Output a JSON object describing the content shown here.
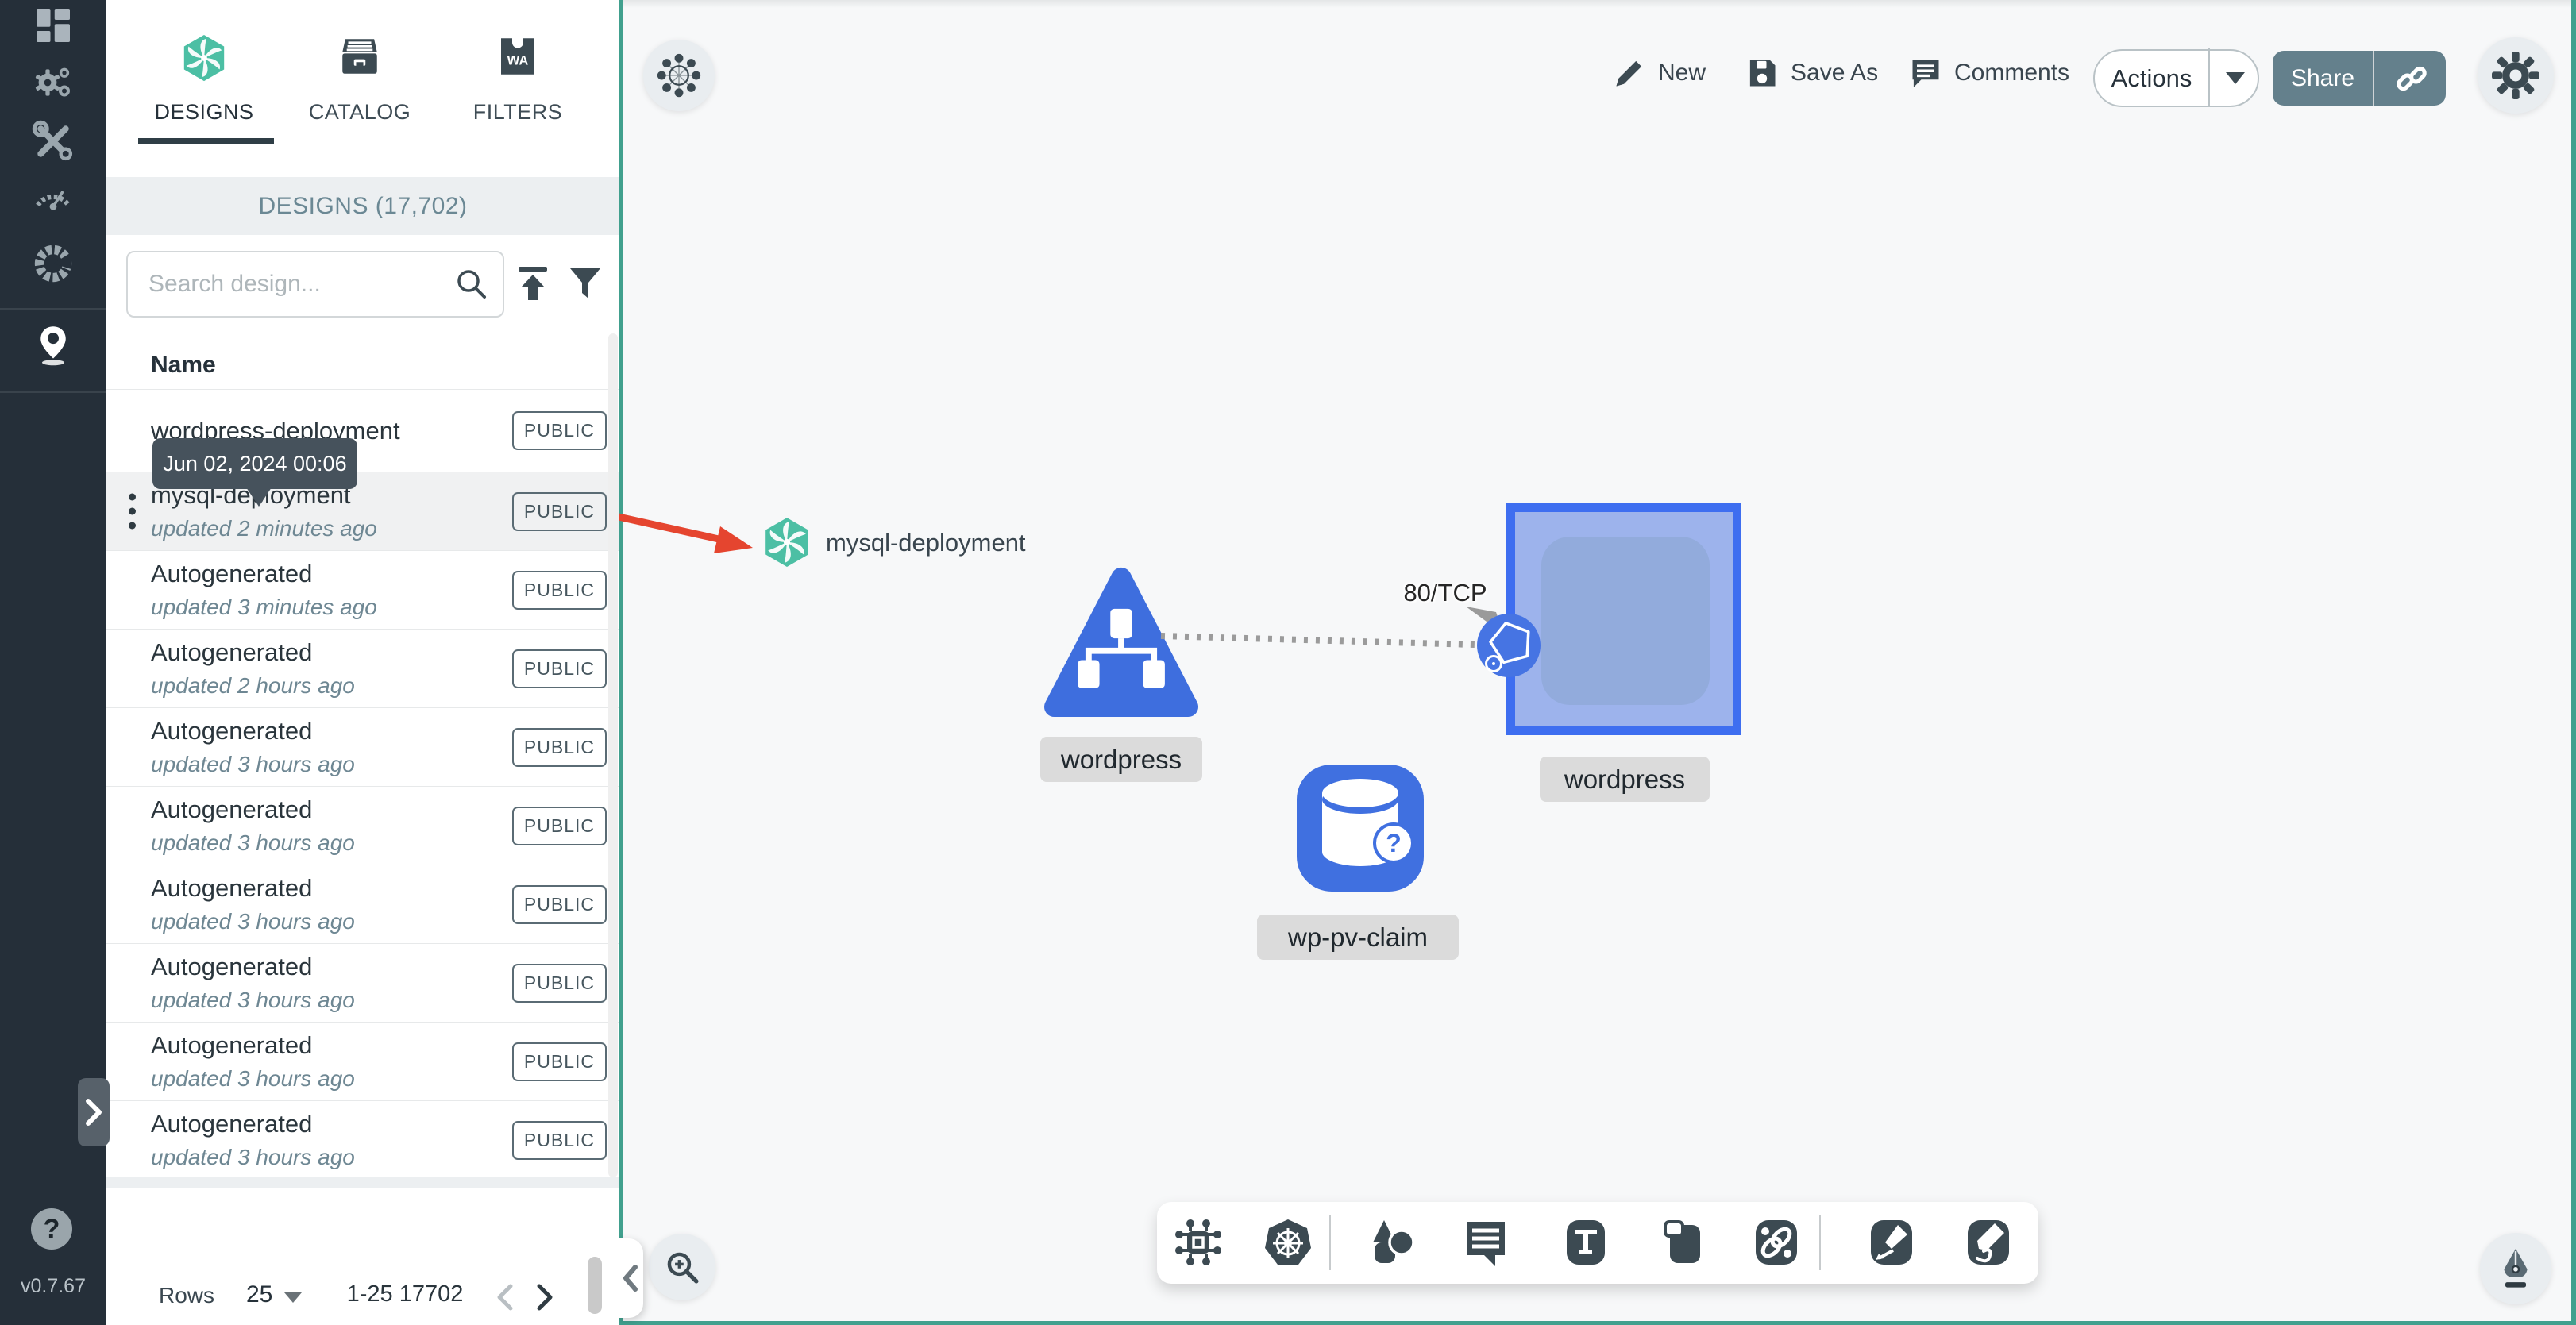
{
  "sidebar": {
    "icons": [
      "dashboard",
      "lifecycle",
      "configuration",
      "performance",
      "extensions",
      "kanvas"
    ],
    "help": "?",
    "version": "v0.7.67"
  },
  "panel": {
    "tabs": [
      {
        "label": "DESIGNS",
        "active": true
      },
      {
        "label": "CATALOG",
        "active": false
      },
      {
        "label": "FILTERS",
        "active": false
      }
    ],
    "header": "DESIGNS (17,702)",
    "search_placeholder": "Search design...",
    "table_header": "Name",
    "tooltip": "Jun 02, 2024 00:06",
    "rows": [
      {
        "name": "wordpress-deployment",
        "subtitle": "",
        "badge": "PUBLIC",
        "hovered": false
      },
      {
        "name": "mysql-deployment",
        "subtitle": "updated 2 minutes ago",
        "badge": "PUBLIC",
        "hovered": true
      },
      {
        "name": "Autogenerated",
        "subtitle": "updated 3 minutes ago",
        "badge": "PUBLIC",
        "hovered": false
      },
      {
        "name": "Autogenerated",
        "subtitle": "updated 2 hours ago",
        "badge": "PUBLIC",
        "hovered": false
      },
      {
        "name": "Autogenerated",
        "subtitle": "updated 3 hours ago",
        "badge": "PUBLIC",
        "hovered": false
      },
      {
        "name": "Autogenerated",
        "subtitle": "updated 3 hours ago",
        "badge": "PUBLIC",
        "hovered": false
      },
      {
        "name": "Autogenerated",
        "subtitle": "updated 3 hours ago",
        "badge": "PUBLIC",
        "hovered": false
      },
      {
        "name": "Autogenerated",
        "subtitle": "updated 3 hours ago",
        "badge": "PUBLIC",
        "hovered": false
      },
      {
        "name": "Autogenerated",
        "subtitle": "updated 3 hours ago",
        "badge": "PUBLIC",
        "hovered": false
      },
      {
        "name": "Autogenerated",
        "subtitle": "updated 3 hours ago",
        "badge": "PUBLIC",
        "hovered": false
      }
    ],
    "footer": {
      "rows_label": "Rows",
      "per_page": "25",
      "range": "1-25 17702"
    }
  },
  "canvas": {
    "toolbar": {
      "new_label": "New",
      "save_as_label": "Save As",
      "comments_label": "Comments",
      "actions_label": "Actions",
      "share_label": "Share"
    },
    "nodes": {
      "mysql_label": "mysql-deployment",
      "service_label": "wordpress",
      "deployment_label": "wordpress",
      "pvc_label": "wp-pv-claim",
      "edge_label": "80/TCP"
    }
  },
  "colors": {
    "accent_teal": "#41A08E",
    "node_blue": "#4070E0",
    "selection_border": "#3E6EF0",
    "red_arrow": "#E5452F",
    "slate": "#3C4A52",
    "share_button_bg": "#64808C",
    "meshery_green": "#4CBFA4"
  }
}
